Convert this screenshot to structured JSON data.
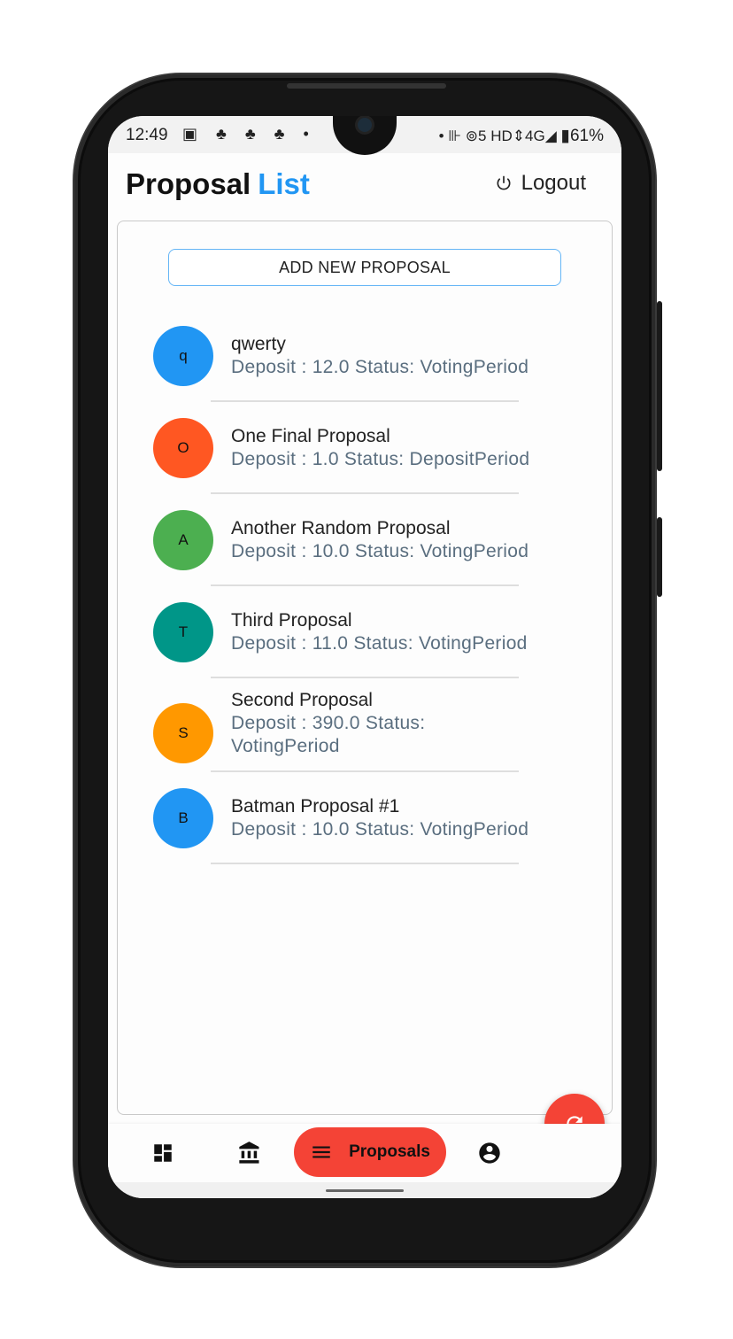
{
  "status_bar": {
    "time": "12:49",
    "left_icons": "▣ ♣ ♣ ♣ •",
    "right_icons": "•  ⊪  ⊚5 HD⇕4G◢",
    "battery": "▮61%"
  },
  "header": {
    "title_main": "Proposal",
    "title_accent": "List",
    "logout_label": "Logout",
    "accent_color": "#2196f3"
  },
  "card": {
    "add_button_label": "ADD NEW PROPOSAL"
  },
  "proposals": [
    {
      "initial": "q",
      "title": "qwerty",
      "subtitle": "Deposit : 12.0 Status: VotingPeriod",
      "color": "#2196f3"
    },
    {
      "initial": "O",
      "title": "One Final Proposal",
      "subtitle": "Deposit : 1.0 Status: DepositPeriod",
      "color": "#ff5722"
    },
    {
      "initial": "A",
      "title": "Another Random Proposal",
      "subtitle": "Deposit : 10.0 Status: VotingPeriod",
      "color": "#4caf50"
    },
    {
      "initial": "T",
      "title": "Third Proposal",
      "subtitle": "Deposit : 11.0 Status: VotingPeriod",
      "color": "#009688"
    },
    {
      "initial": "S",
      "title": "Second Proposal",
      "subtitle": "Deposit : 390.0 Status: VotingPeriod",
      "color": "#ff9800"
    },
    {
      "initial": "B",
      "title": "Batman Proposal #1",
      "subtitle": "Deposit : 10.0 Status: VotingPeriod",
      "color": "#2196f3"
    }
  ],
  "fab": {
    "icon": "refresh-icon",
    "color": "#f44336"
  },
  "bottom_nav": {
    "items": [
      {
        "icon": "dashboard-icon"
      },
      {
        "icon": "bank-icon"
      },
      {
        "icon": "menu-icon",
        "label": "Proposals",
        "active": true
      },
      {
        "icon": "account-circle-icon"
      }
    ],
    "active_color": "#f44336"
  }
}
